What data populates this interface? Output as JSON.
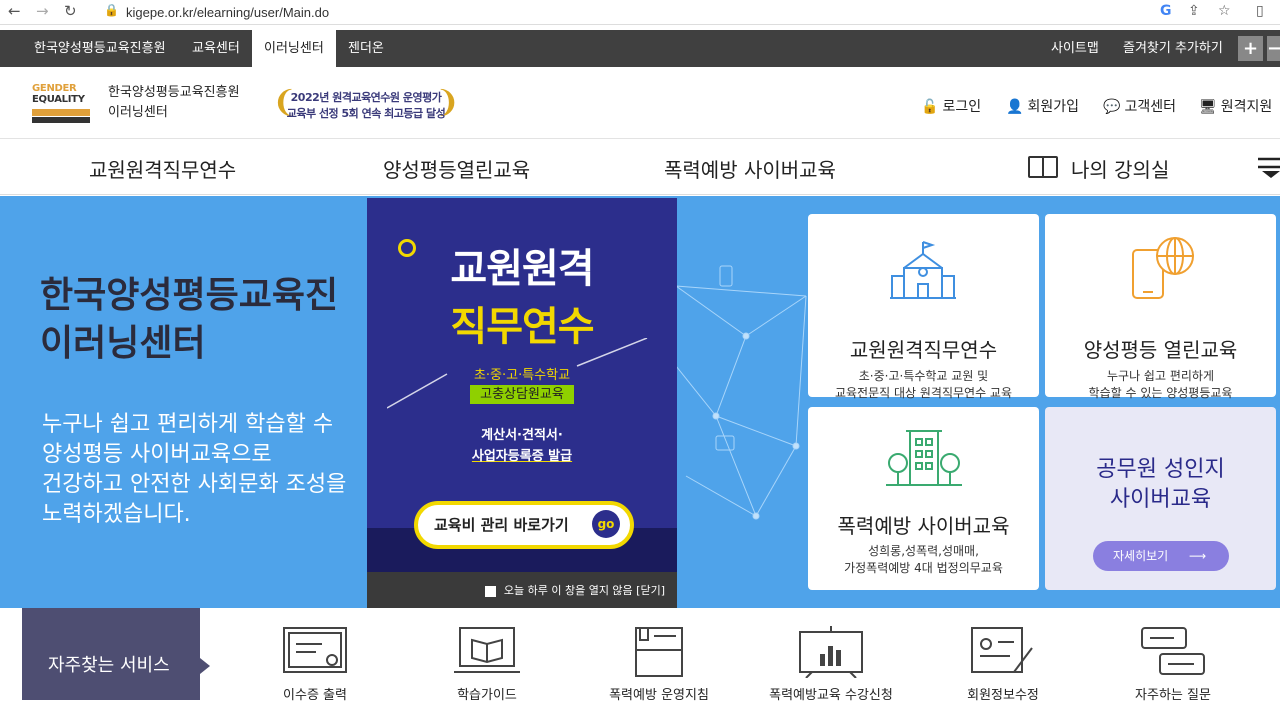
{
  "browser": {
    "url": "kigepe.or.kr/elearning/user/Main.do"
  },
  "topbar": {
    "tabs": [
      "한국양성평등교육진흥원",
      "교육센터",
      "이러닝센터",
      "젠더온"
    ],
    "right": [
      "사이트맵",
      "즐겨찾기 추가하기"
    ]
  },
  "header": {
    "logo": {
      "line1": "GENDER",
      "line2": "EQUALITY"
    },
    "org_name": "한국양성평등교육진흥원",
    "center_name": "이러닝센터",
    "badge": {
      "line1": "2022년 원격교육연수원 운영평가",
      "line2": "교육부 선정 5회 연속 최고등급 달성"
    },
    "util": [
      "로그인",
      "회원가입",
      "고객센터",
      "원격지원"
    ]
  },
  "gnb": {
    "items": [
      "교원원격직무연수",
      "양성평등열린교육",
      "폭력예방 사이버교육",
      "나의 강의실"
    ]
  },
  "hero": {
    "title_line1": "한국양성평등교육진",
    "title_line2": "이러닝센터",
    "desc": [
      "누구나 쉽고 편리하게 학습할 수",
      "양성평등 사이버교육으로",
      "건강하고 안전한 사회문화 조성을",
      "노력하겠습니다."
    ]
  },
  "cards": [
    {
      "title": "교원원격직무연수",
      "desc": [
        "초·중·고·특수학교 교원 및",
        "교육전문직 대상 원격직무연수 교육"
      ]
    },
    {
      "title": "양성평등 열린교육",
      "desc": [
        "누구나 쉽고 편리하게",
        "학습할 수 있는 양성평등교육"
      ]
    },
    {
      "title": "폭력예방 사이버교육",
      "desc": [
        "성희롱,성폭력,성매매,",
        "가정폭력예방 4대 법정의무교육"
      ]
    },
    {
      "title_line1": "공무원 성인지",
      "title_line2": "사이버교육",
      "button": "자세히보기"
    }
  ],
  "popup": {
    "line1": "교원원격",
    "line2": "직무연수",
    "schools": "초·중·고·특수학교",
    "tag": "고충상담원교육",
    "issue1": "계산서·견적서·",
    "issue2": "사업자등록증 발급",
    "go_label": "교육비 관리 바로가기",
    "go_badge": "go",
    "footer": "오늘 하루 이 창을 열지 않음 [닫기]"
  },
  "services": {
    "label": "자주찾는 서비스",
    "items": [
      "이수증 출력",
      "학습가이드",
      "폭력예방 운영지침",
      "폭력예방교육 수강신청",
      "회원정보수정",
      "자주하는 질문"
    ]
  }
}
